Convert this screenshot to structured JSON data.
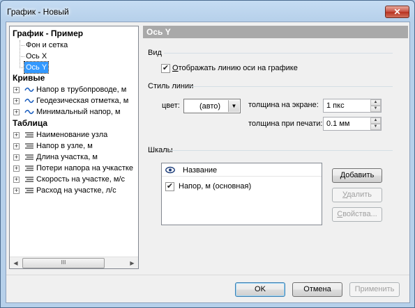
{
  "window": {
    "title": "График - Новый",
    "close_symbol": "✕"
  },
  "tree": {
    "root": "График - Пример",
    "chart_children": [
      "Фон и сетка",
      "Ось X",
      "Ось Y"
    ],
    "curves_header": "Кривые",
    "curves": [
      "Напор в трубопроводе, м",
      "Геодезическая отметка, м",
      "Минимальный напор, м"
    ],
    "table_header": "Таблица",
    "table_items": [
      "Наименование узла",
      "Напор в узле, м",
      "Длина участка, м",
      "Потери напора на учкастке",
      "Скорость на участке, м/с",
      "Расход на участке, л/с"
    ],
    "scroll_grip": "III"
  },
  "panel": {
    "header": "Ось Y",
    "view_group": "Вид",
    "show_axis_label": "Отображать линию оси на графике",
    "show_axis_underline_char": "О",
    "line_style_group": "Стиль линии",
    "color_label": "цвет:",
    "color_value": "(авто)",
    "screen_width_label": "толщина на экране:",
    "screen_width_value": "1 пкс",
    "print_width_label": "толщина при печати:",
    "print_width_value": "0.1 мм",
    "scales_group": "Шкалы",
    "scales_column": "Название",
    "scales_rows": [
      "Напор, м (основная)"
    ],
    "add_button": "Добавить",
    "delete_button": "Удалить",
    "properties_button": "Свойства..."
  },
  "footer": {
    "ok": "OK",
    "cancel": "Отмена",
    "apply": "Применить"
  }
}
